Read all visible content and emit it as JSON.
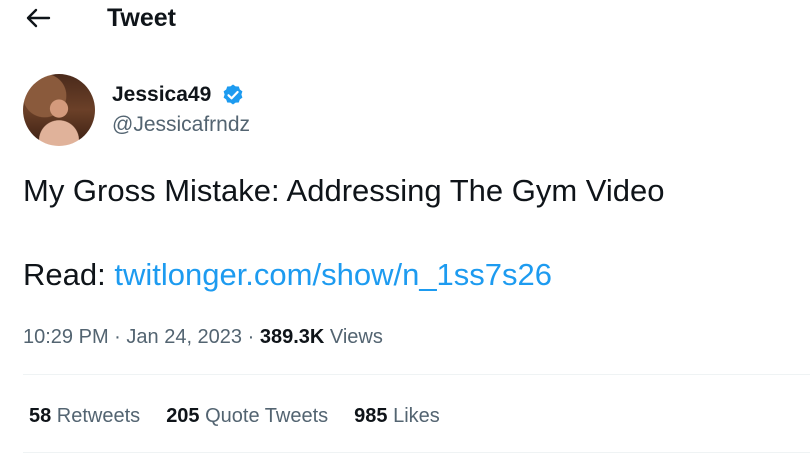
{
  "header": {
    "title": "Tweet",
    "back_icon": "arrow-left-icon"
  },
  "author": {
    "display_name": "Jessica49",
    "handle": "@Jessicafrndz",
    "verified_icon": "verified-badge-icon",
    "verified_color": "#1d9bf0"
  },
  "tweet": {
    "text": "My Gross Mistake: Addressing The Gym Video",
    "read_prefix": "Read: ",
    "link_text": "twitlonger.com/show/n_1ss7s26",
    "link_color": "#1d9bf0"
  },
  "meta": {
    "time": "10:29 PM",
    "separator": " · ",
    "date": "Jan 24, 2023",
    "views_count": "389.3K",
    "views_label": " Views"
  },
  "stats": {
    "retweets_count": "58",
    "retweets_label": " Retweets",
    "quotes_count": "205",
    "quotes_label": " Quote Tweets",
    "likes_count": "985",
    "likes_label": " Likes"
  }
}
